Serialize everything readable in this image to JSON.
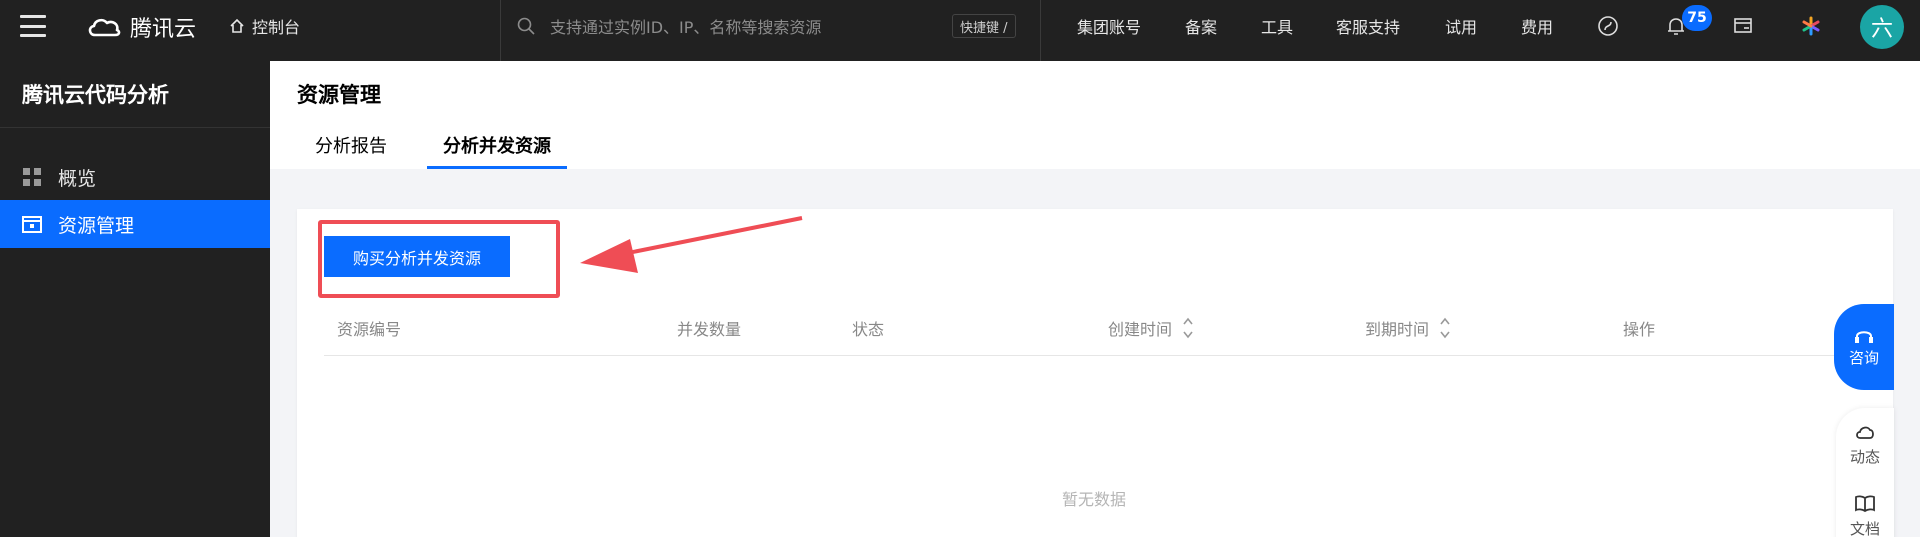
{
  "topbar": {
    "brand": "腾讯云",
    "console_label": "控制台",
    "search_placeholder": "支持通过实例ID、IP、名称等搜索资源",
    "shortcut_label": "快捷键 /",
    "nav": [
      "集团账号",
      "备案",
      "工具",
      "客服支持",
      "试用",
      "费用"
    ],
    "notification_count": "75",
    "avatar_text": "六"
  },
  "sidebar": {
    "title": "腾讯云代码分析",
    "items": [
      {
        "label": "概览",
        "icon": "grid-icon",
        "active": false
      },
      {
        "label": "资源管理",
        "icon": "folder-icon",
        "active": true
      }
    ]
  },
  "page": {
    "title": "资源管理",
    "tabs": [
      {
        "label": "分析报告",
        "active": false
      },
      {
        "label": "分析并发资源",
        "active": true
      }
    ]
  },
  "toolbar": {
    "buy_button": "购买分析并发资源"
  },
  "table": {
    "columns": [
      "资源编号",
      "并发数量",
      "状态",
      "创建时间",
      "到期时间",
      "操作"
    ],
    "empty_text": "暂无数据"
  },
  "float_tools": {
    "consult": "咨询",
    "items": [
      "动态",
      "文档"
    ]
  },
  "colors": {
    "accent": "#0a6cff",
    "topbar_bg": "#212121",
    "annotation_red": "#ef4d55"
  }
}
